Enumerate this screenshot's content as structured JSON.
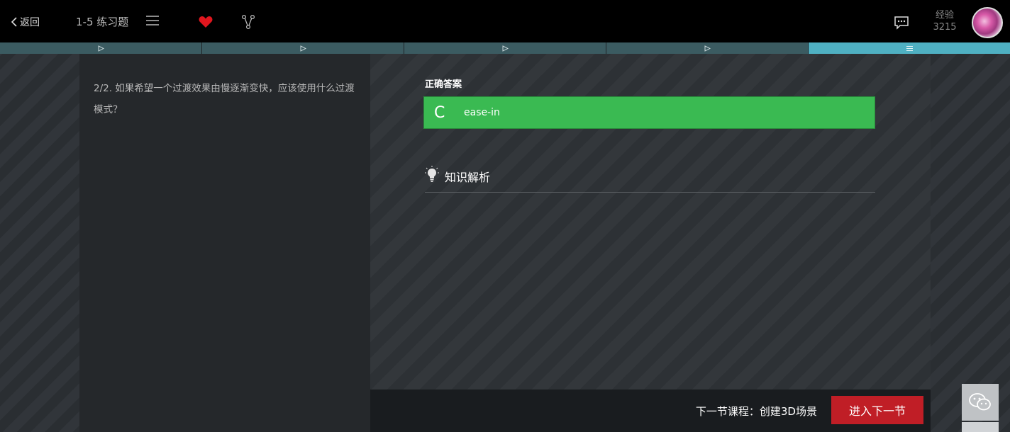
{
  "header": {
    "back_label": "返回",
    "lesson_title": "1-5 练习题",
    "experience_label": "经验",
    "experience_value": "3215"
  },
  "icons": {
    "back": "chevron-left-icon",
    "menu": "menu-icon",
    "favorite": "heart-icon",
    "share": "branch-icon",
    "chat": "chat-icon",
    "bulb": "lightbulb-icon",
    "wechat": "wechat-icon"
  },
  "steps": [
    {
      "icon": "play-icon",
      "active": false
    },
    {
      "icon": "play-icon",
      "active": false
    },
    {
      "icon": "play-icon",
      "active": false
    },
    {
      "icon": "play-icon",
      "active": false
    },
    {
      "icon": "list-icon",
      "active": true
    }
  ],
  "question": {
    "text": "2/2. 如果希望一个过渡效果由慢逐渐变快，应该使用什么过渡模式？"
  },
  "answer": {
    "label": "正确答案",
    "option_letter": "C",
    "option_value": "ease-in"
  },
  "analysis": {
    "title": "知识解析"
  },
  "footer": {
    "next_lesson_text": "下一节课程：创建3D场景",
    "next_button_label": "进入下一节"
  },
  "colors": {
    "header_bg": "#000000",
    "step_bg": "#3b5b61",
    "step_active": "#4fb0c2",
    "correct_green": "#3aba52",
    "next_button_red": "#c01e26",
    "heart_red": "#e0161e"
  }
}
